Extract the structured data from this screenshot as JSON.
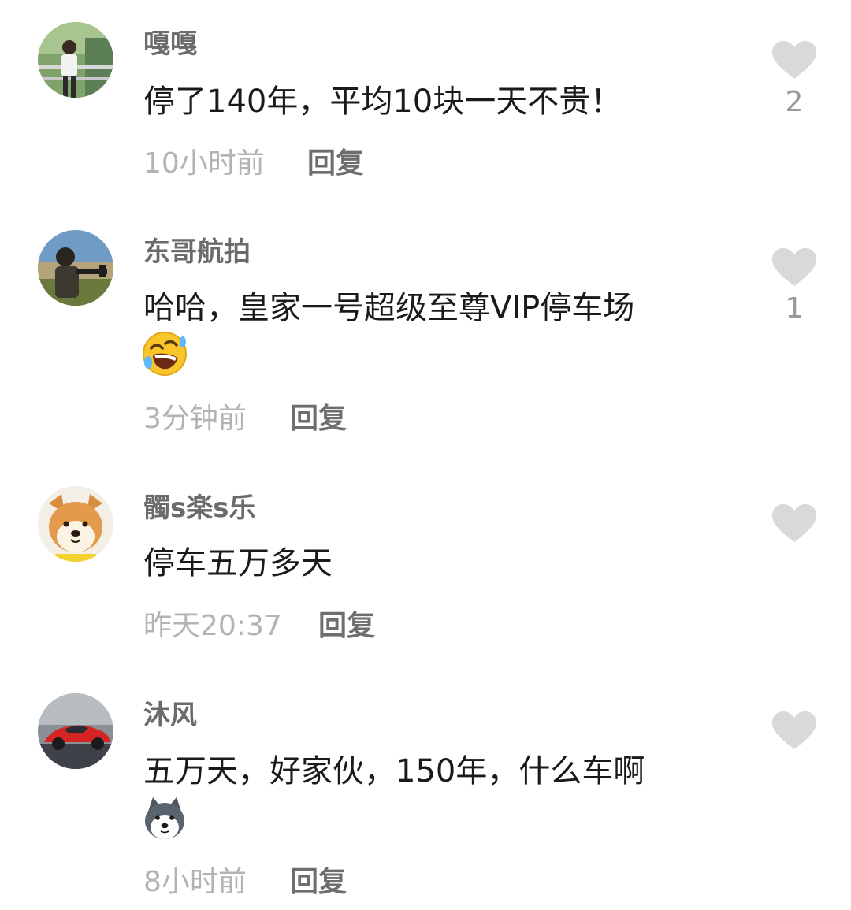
{
  "comments": [
    {
      "username": "嘎嘎",
      "text": "停了140年，平均10块一天不贵！",
      "time": "10小时前",
      "reply_label": "回复",
      "like_count": "2",
      "avatar_icon": "person-portrait-avatar",
      "emoji": null
    },
    {
      "username": "东哥航拍",
      "text": "哈哈，皇家一号超级至尊VIP停车场",
      "time": "3分钟前",
      "reply_label": "回复",
      "like_count": "1",
      "avatar_icon": "person-outdoor-avatar",
      "emoji": "rolling-laughing-emoji"
    },
    {
      "username": "髑s楽s乐",
      "text": "停车五万多天",
      "time": "昨天20:37",
      "reply_label": "回复",
      "like_count": "",
      "avatar_icon": "shiba-dog-avatar",
      "emoji": null
    },
    {
      "username": "沐风",
      "text": "五万天，好家伙，150年，什么车啊",
      "time": "8小时前",
      "reply_label": "回复",
      "like_count": "",
      "avatar_icon": "red-sports-car-avatar",
      "emoji": "husky-dog-emoji"
    }
  ],
  "colors": {
    "username": "#6b6b6b",
    "text": "#1a1a1a",
    "time": "#b3b3b3",
    "reply": "#6e6e6e",
    "like_icon": "#d9d9d9",
    "like_count": "#9a9a9a"
  }
}
